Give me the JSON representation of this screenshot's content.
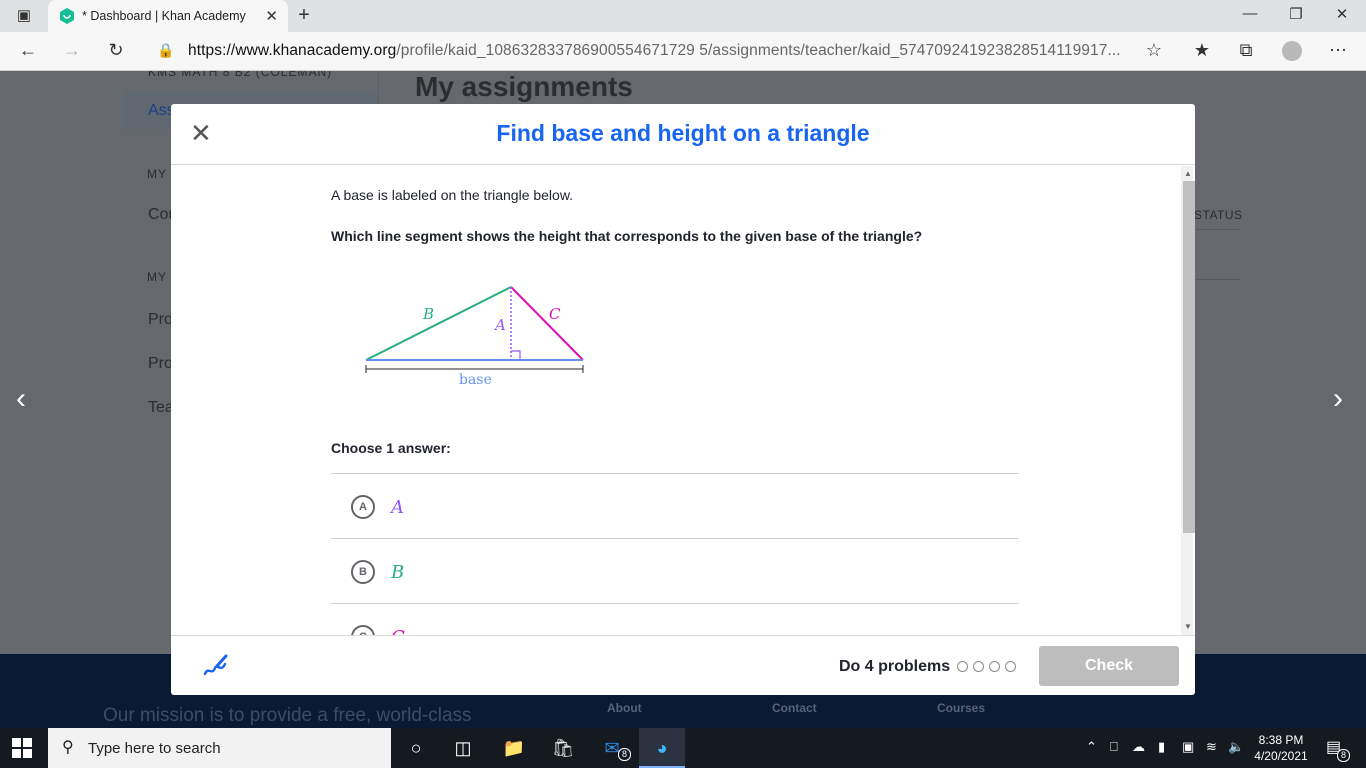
{
  "browser": {
    "tab_title": "* Dashboard | Khan Academy",
    "url_host": "https://www.khanacademy.org",
    "url_path": "/profile/kaid_108632833786900554671729 5/assignments/teacher/kaid_574709241923828514119917..."
  },
  "background_page": {
    "top_label": "KMS MATH 8 B2 (COLEMAN)",
    "assignments_item": "Ass",
    "section_my_1": "MY",
    "courses_item": "Cou",
    "section_my_2": "MY",
    "item_pro_1": "Pro",
    "item_pro_2": "Pro",
    "item_tea": "Tea",
    "heading": "My assignments",
    "status_column": "STATUS",
    "footer_mission": "Our mission is to provide a free, world-class",
    "footer_links": [
      "About",
      "Contact",
      "Courses"
    ]
  },
  "modal": {
    "title": "Find base and height on a triangle",
    "intro": "A base is labeled on the triangle below.",
    "question": "Which line segment shows the height that corresponds to the given base of the triangle?",
    "diagram": {
      "label_b": "B",
      "label_a": "A",
      "label_c": "C",
      "label_base": "base",
      "colors": {
        "B": "#28ae7b",
        "A": "#9059ff",
        "C": "#e00fb5",
        "base": "#6495ed"
      }
    },
    "choose_label": "Choose 1 answer:",
    "choices": [
      {
        "letter": "A",
        "value": "A",
        "color": "#9059ff"
      },
      {
        "letter": "B",
        "value": "B",
        "color": "#28ae7b"
      },
      {
        "letter": "C",
        "value": "C",
        "color": "#e00fb5"
      }
    ],
    "do_problems": "Do 4 problems",
    "check_label": "Check",
    "progress_dots_total": 4
  },
  "taskbar": {
    "search_placeholder": "Type here to search",
    "time": "8:38 PM",
    "date": "4/20/2021",
    "mail_badge": "8",
    "notification_badge": "8"
  }
}
